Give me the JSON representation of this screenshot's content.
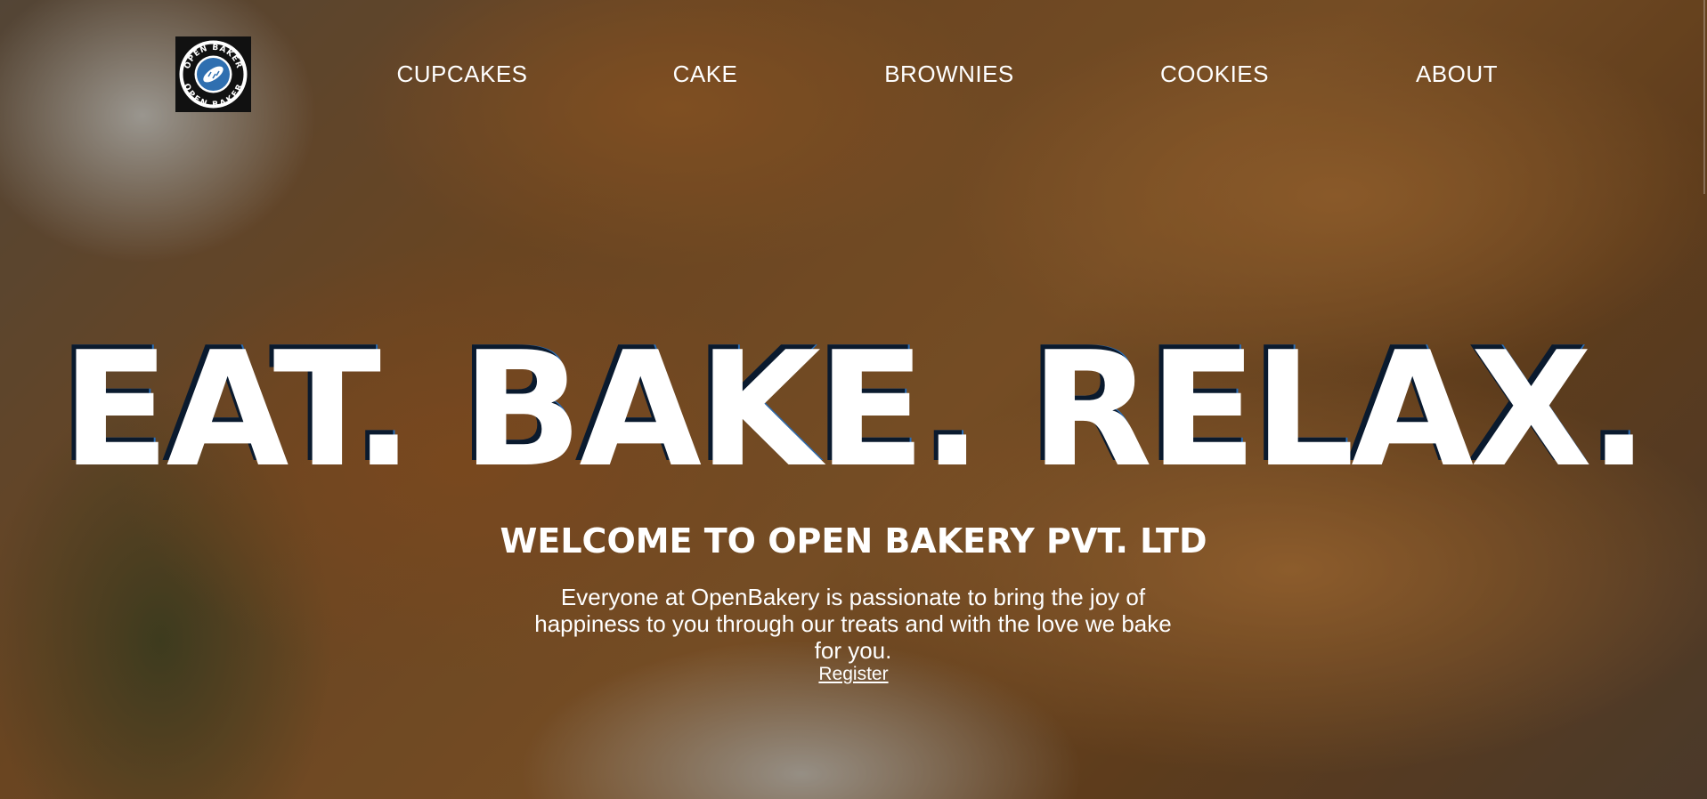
{
  "brand": {
    "logo_text_top": "OPEN BAKER",
    "logo_text_bottom": "OPEN BAKER",
    "colors": {
      "logo_background": "#111111",
      "logo_badge": "#2f6fb0",
      "text": "#ffffff",
      "headline_shadow": "#2a6db5"
    }
  },
  "nav": {
    "items": [
      {
        "label": "CUPCAKES"
      },
      {
        "label": "CAKE"
      },
      {
        "label": "BROWNIES"
      },
      {
        "label": "COOKIES"
      },
      {
        "label": "ABOUT"
      }
    ]
  },
  "hero": {
    "headline": "EAT. BAKE. RELAX.",
    "welcome": "WELCOME TO OPEN BAKERY PVT. LTD",
    "tagline": "Everyone at OpenBakery is passionate to bring the joy of happiness to you through our treats and with the love we bake for you.",
    "register_label": "Register"
  }
}
